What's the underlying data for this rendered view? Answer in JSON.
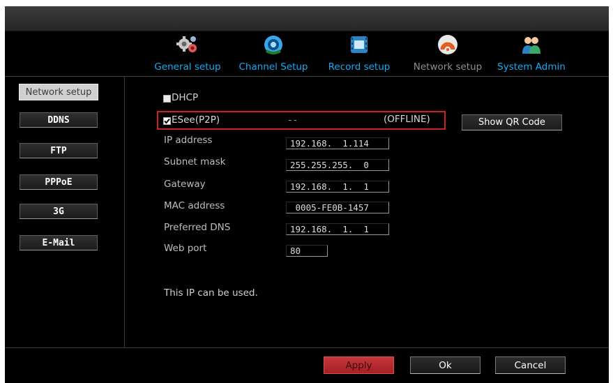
{
  "tabs": [
    {
      "label": "General setup",
      "icon": "gears-icon"
    },
    {
      "label": "Channel Setup",
      "icon": "camera-icon"
    },
    {
      "label": "Record setup",
      "icon": "film-icon"
    },
    {
      "label": "Network setup",
      "icon": "wifi-icon"
    },
    {
      "label": "System Admin",
      "icon": "users-icon"
    }
  ],
  "active_tab": "Network setup",
  "sidebar": {
    "items": [
      {
        "label": "Network setup"
      },
      {
        "label": "DDNS"
      },
      {
        "label": "FTP"
      },
      {
        "label": "PPPoE"
      },
      {
        "label": "3G"
      },
      {
        "label": "E-Mail"
      }
    ]
  },
  "form": {
    "dhcp": {
      "label": "DHCP",
      "checked": false
    },
    "esee": {
      "label": "ESee(P2P)",
      "checked": true,
      "id_value": "--",
      "status": "(OFFLINE)"
    },
    "qr_button": "Show QR Code",
    "fields": [
      {
        "label": "IP address",
        "value": "192.168.  1.114"
      },
      {
        "label": "Subnet mask",
        "value": "255.255.255.  0"
      },
      {
        "label": "Gateway",
        "value": "192.168.  1.  1"
      },
      {
        "label": "MAC address",
        "value": " 0005-FE0B-1457"
      },
      {
        "label": "Preferred DNS",
        "value": "192.168.  1.  1"
      },
      {
        "label": "Web port",
        "value": "80"
      }
    ],
    "message": "This IP can be used."
  },
  "footer": {
    "apply": "Apply",
    "ok": "Ok",
    "cancel": "Cancel"
  },
  "colors": {
    "accent": "#1aa9f0",
    "apply": "#b8272d",
    "highlight": "#d01f20"
  }
}
